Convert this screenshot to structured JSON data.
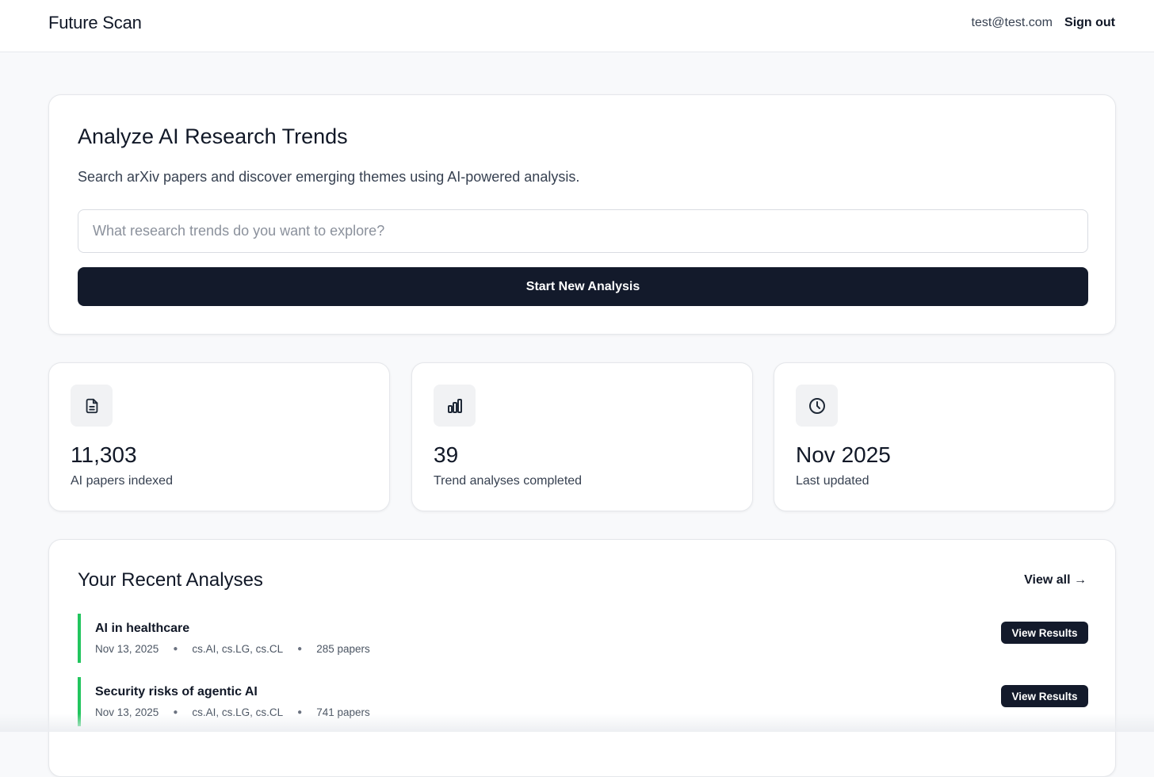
{
  "header": {
    "brand": "Future Scan",
    "email": "test@test.com",
    "signout_label": "Sign out"
  },
  "hero": {
    "title": "Analyze AI Research Trends",
    "subtitle": "Search arXiv papers and discover emerging themes using AI-powered analysis.",
    "search_placeholder": "What research trends do you want to explore?",
    "search_value": "",
    "start_label": "Start New Analysis"
  },
  "stats": [
    {
      "icon": "document-icon",
      "value": "11,303",
      "label": "AI papers indexed"
    },
    {
      "icon": "bar-chart-icon",
      "value": "39",
      "label": "Trend analyses completed"
    },
    {
      "icon": "clock-icon",
      "value": "Nov 2025",
      "label": "Last updated"
    }
  ],
  "recent": {
    "title": "Your Recent Analyses",
    "view_all_label": "View all →",
    "accent_color": "#22c55e",
    "items": [
      {
        "title": "AI in healthcare",
        "date": "Nov 13, 2025",
        "categories": "cs.AI, cs.LG, cs.CL",
        "papers": "285 papers",
        "button_label": "View Results"
      },
      {
        "title": "Security risks of agentic AI",
        "date": "Nov 13, 2025",
        "categories": "cs.AI, cs.LG, cs.CL",
        "papers": "741 papers",
        "button_label": "View Results"
      }
    ]
  },
  "colors": {
    "primary_button": "#131a2b",
    "background": "#f8f9fb"
  }
}
